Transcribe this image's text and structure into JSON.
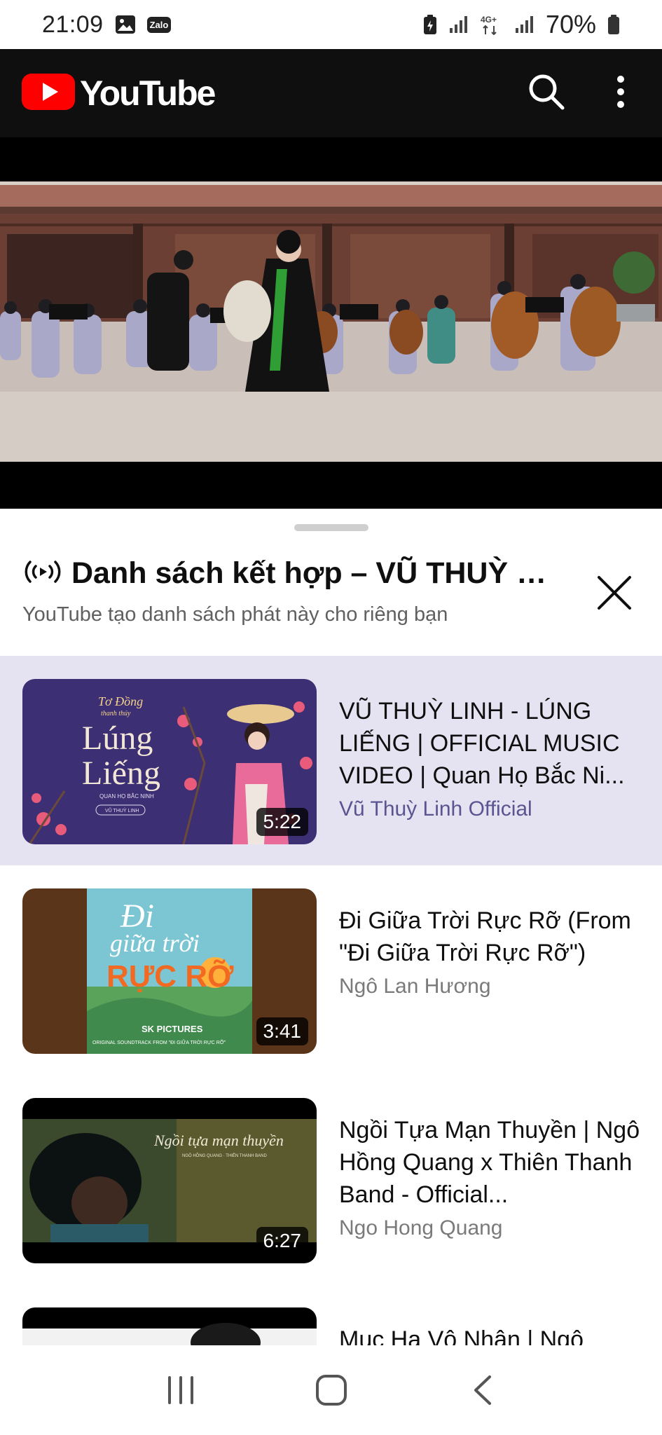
{
  "status_bar": {
    "time": "21:09",
    "zalo_label": "Zalo",
    "network_label": "4G+",
    "battery": "70%"
  },
  "header": {
    "wordmark": "YouTube",
    "brand_color": "#FF0000",
    "icons": [
      "search-icon",
      "more-vert-icon"
    ]
  },
  "playlist": {
    "title": "Danh sách kết hợp – VŨ THUỲ LINH",
    "subtitle": "YouTube tạo danh sách phát này cho riêng bạn",
    "videos": [
      {
        "title": "VŨ THUỲ LINH - LÚNG LIẾNG | OFFICIAL MUSIC VIDEO | Quan Họ Bắc Ni...",
        "channel": "Vũ Thuỳ Linh Official",
        "duration": "5:22",
        "active": true,
        "thumb_brand": "Tơ Đồng",
        "thumb_brand_sub": "thanh thúy",
        "thumb_title_1": "Lúng",
        "thumb_title_2": "Liếng",
        "thumb_sub": "QUAN HỌ BẮC NINH",
        "thumb_artist": "VŨ THUỲ LINH"
      },
      {
        "title": "Đi Giữa Trời Rực Rỡ (From \"Đi Giữa Trời Rực Rỡ\")",
        "channel": "Ngô Lan Hương",
        "duration": "3:41",
        "active": false,
        "thumb_title_1": "Đi",
        "thumb_title_2": "giữa trời",
        "thumb_title_3": "RỰC RỠ",
        "thumb_studio": "SK PICTURES",
        "thumb_caption": "ORIGINAL SOUNDTRACK FROM \"ĐI GIỮA TRỜI RỰC RỠ\""
      },
      {
        "title": "Ngồi Tựa Mạn Thuyền | Ngô Hồng Quang x Thiên Thanh Band - Official...",
        "channel": "Ngo Hong Quang",
        "duration": "6:27",
        "active": false,
        "thumb_title": "Ngồi tựa mạn thuyền",
        "thumb_caption": "NGÔ HỒNG QUANG · THIÊN THANH BAND"
      },
      {
        "title": "Mục Hạ Vô Nhân | Ngô",
        "channel": "",
        "duration": "",
        "active": false
      }
    ]
  },
  "navbar": {
    "icons": [
      "recents-icon",
      "home-icon",
      "back-icon"
    ]
  }
}
